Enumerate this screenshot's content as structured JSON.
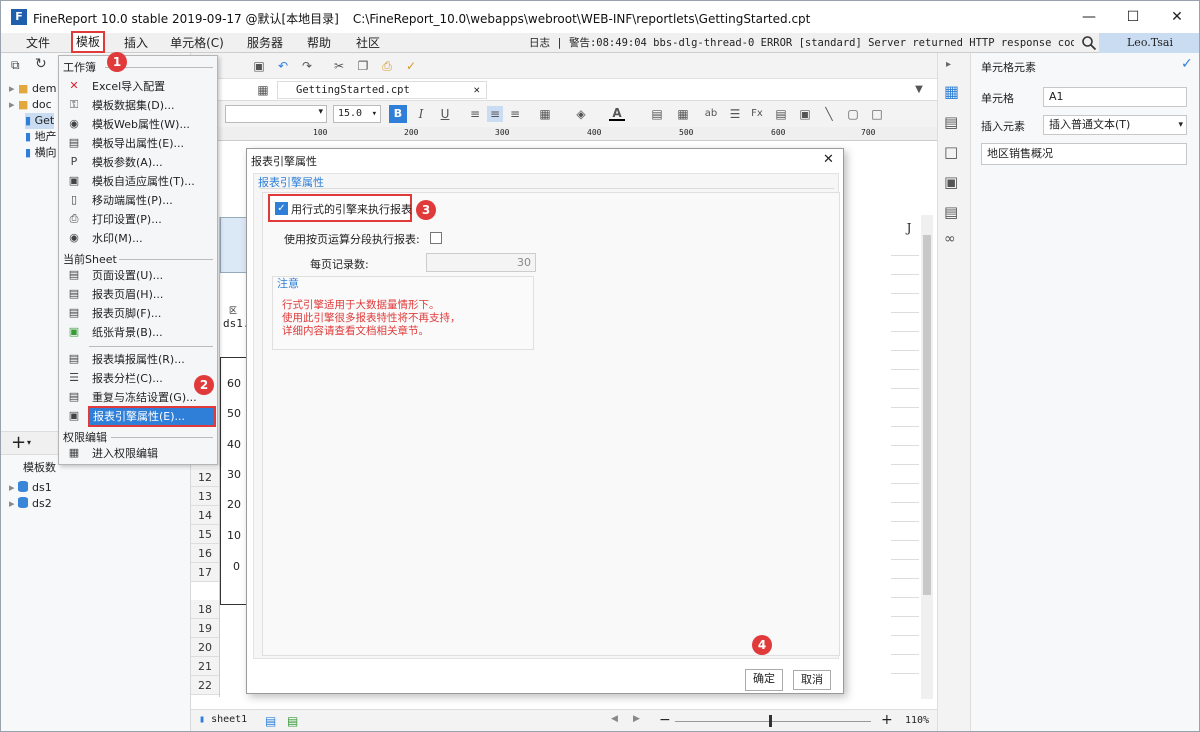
{
  "window": {
    "title": "FineReport 10.0 stable 2019-09-17 @默认[本地目录]",
    "path": "C:\\FineReport_10.0\\webapps\\webroot\\WEB-INF\\reportlets\\GettingStarted.cpt",
    "logo": "F"
  },
  "menubar": {
    "items": [
      "文件",
      "模板",
      "插入",
      "单元格(C)",
      "服务器",
      "帮助",
      "社区"
    ],
    "log": "日志 | 警告:08:49:04 bbs-dlg-thread-0 ERROR [standard] Server returned HTTP response code: 405 fo...",
    "user": "Leo.Tsai"
  },
  "left_tree": {
    "items": [
      "dem",
      "doc",
      "Get",
      "地产",
      "横向"
    ],
    "datasets_label": "模板数",
    "datasets": [
      "ds1",
      "ds2"
    ]
  },
  "dropdown": {
    "section1": "工作簿",
    "items1": [
      "Excel导入配置",
      "模板数据集(D)...",
      "模板Web属性(W)...",
      "模板导出属性(E)...",
      "模板参数(A)...",
      "模板自适应属性(T)...",
      "移动端属性(P)...",
      "打印设置(P)...",
      "水印(M)..."
    ],
    "section2": "当前Sheet",
    "items2": [
      "页面设置(U)...",
      "报表页眉(H)...",
      "报表页脚(F)...",
      "纸张背景(B)..."
    ],
    "items3": [
      "报表填报属性(R)...",
      "报表分栏(C)...",
      "重复与冻结设置(G)...",
      "报表引擎属性(E)..."
    ],
    "section3": "权限编辑",
    "items4": [
      "进入权限编辑"
    ]
  },
  "editor": {
    "tab": "GettingStarted.cpt",
    "font_size": "15.0",
    "ruler": [
      "100",
      "200",
      "300",
      "400",
      "500",
      "600",
      "700"
    ],
    "rows": [
      "12",
      "13",
      "14",
      "15",
      "16",
      "17",
      "18",
      "19",
      "20",
      "21",
      "22",
      "23"
    ],
    "col_J": "J",
    "chart_ticks": [
      "60",
      "50",
      "40",
      "30",
      "20",
      "10",
      "0"
    ],
    "partial_texts": [
      "ds1.",
      "区"
    ],
    "sheet_tab": "sheet1",
    "zoom": "110%"
  },
  "dialog": {
    "title": "报表引擎属性",
    "section": "报表引擎属性",
    "checkbox1_label": "用行式的引擎来执行报表",
    "checkbox1_checked": true,
    "checkbox2_label": "使用按页运算分段执行报表:",
    "checkbox2_checked": false,
    "per_page_label": "每页记录数:",
    "per_page_value": "30",
    "note_title": "注意",
    "note_lines": [
      "行式引擎适用于大数据量情形下。",
      "使用此引擎很多报表特性将不再支持，",
      "详细内容请查看文档相关章节。"
    ],
    "ok": "确定",
    "cancel": "取消"
  },
  "right_panel": {
    "header": "单元格元素",
    "cell_label": "单元格",
    "cell_value": "A1",
    "insert_label": "插入元素",
    "insert_value": "插入普通文本(T)",
    "content": "地区销售概况"
  },
  "badges": [
    "1",
    "2",
    "3",
    "4"
  ],
  "colors": {
    "highlight": "#e03a3a",
    "accent": "#2f7fd8",
    "selection": "#c9dcf1"
  }
}
